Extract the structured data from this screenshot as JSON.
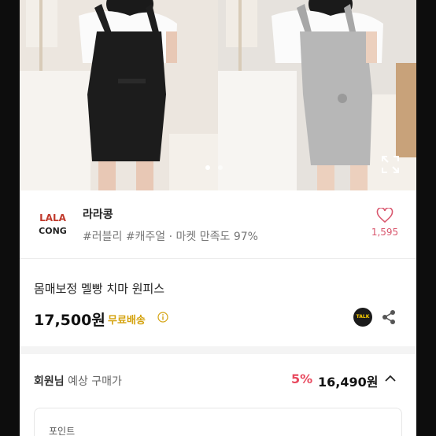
{
  "gallery": {
    "slide_count": 2,
    "active_slide": 1
  },
  "seller": {
    "logo_text_top": "LALA",
    "logo_text_bottom": "CONG",
    "name": "라라콩",
    "tags": "#러블리 #캐주얼 · 마켓 만족도 97%",
    "like_count": "1,595"
  },
  "product": {
    "title": "몸매보정 멜빵 치마 원피스",
    "price": "17,500원",
    "shipping": "무료배송"
  },
  "actions": {
    "talk_label": "TALK"
  },
  "member_price": {
    "label_bold": "회원님",
    "label_rest": " 예상 구매가",
    "discount": "5%",
    "price": "16,490원"
  },
  "points": {
    "label": "포인트"
  },
  "colors": {
    "like": "#d9576e",
    "discount": "#e84a5f",
    "shipping": "#d4a20e",
    "talk_bg": "#1b1b1b",
    "talk_fg": "#ffd200"
  }
}
